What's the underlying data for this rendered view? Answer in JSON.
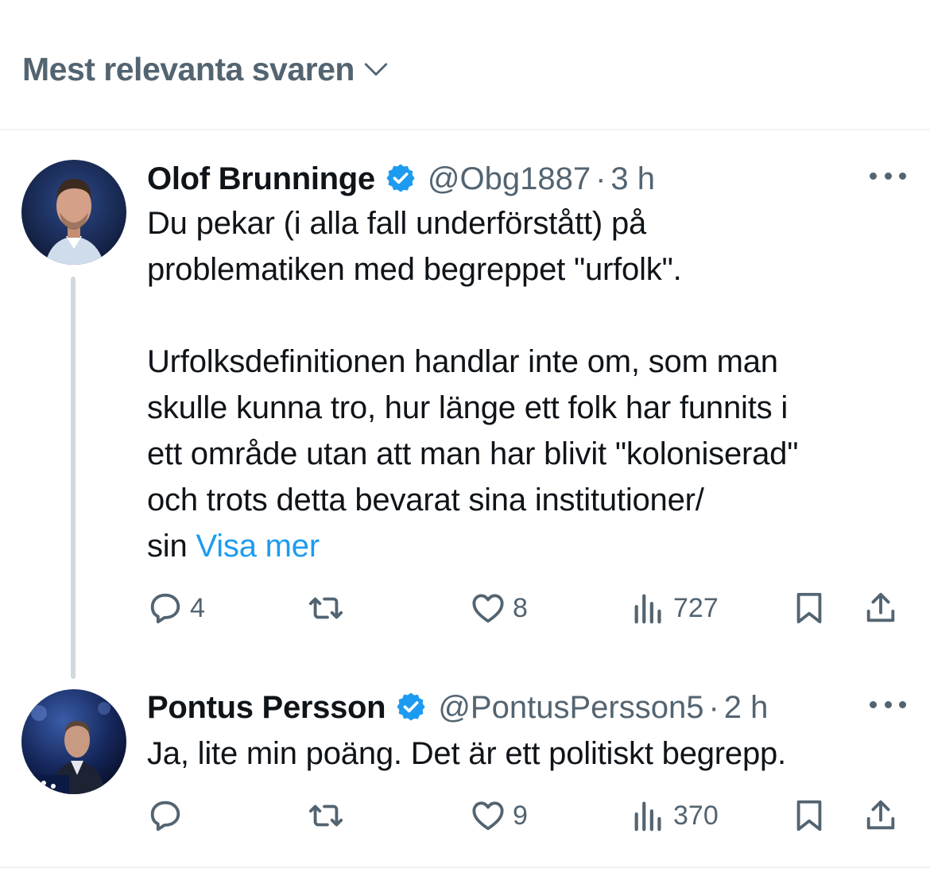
{
  "sort": {
    "label": "Mest relevanta svaren",
    "icon": "chevron-down-icon"
  },
  "tweets": [
    {
      "name": "Olof Brunninge",
      "handle": "@Obg1887",
      "separator": "·",
      "time": "3 h",
      "text_lines_p1": [
        "Du pekar (i alla fall underförstått) på",
        "problematiken med begreppet \"urfolk\"."
      ],
      "text_lines_p2": [
        "Urfolksdefinitionen handlar inte om, som man",
        "skulle kunna tro, hur länge ett folk har funnits i",
        "ett område utan att man har blivit \"koloniserad\"",
        "och trots detta bevarat sina institutioner/"
      ],
      "last_line_prefix": "sin ",
      "show_more": "Visa mer",
      "replies": "4",
      "retweets": "",
      "likes": "8",
      "views": "727"
    },
    {
      "name": "Pontus Persson",
      "handle": "@PontusPersson5",
      "separator": "·",
      "time": "2 h",
      "text": "Ja, lite min poäng. Det är ett politiskt begrepp.",
      "replies": "",
      "retweets": "",
      "likes": "9",
      "views": "370"
    }
  ],
  "colors": {
    "accent": "#1d9bf0",
    "secondary_text": "#536471",
    "primary_text": "#0f1419",
    "divider": "#eff3f4"
  }
}
